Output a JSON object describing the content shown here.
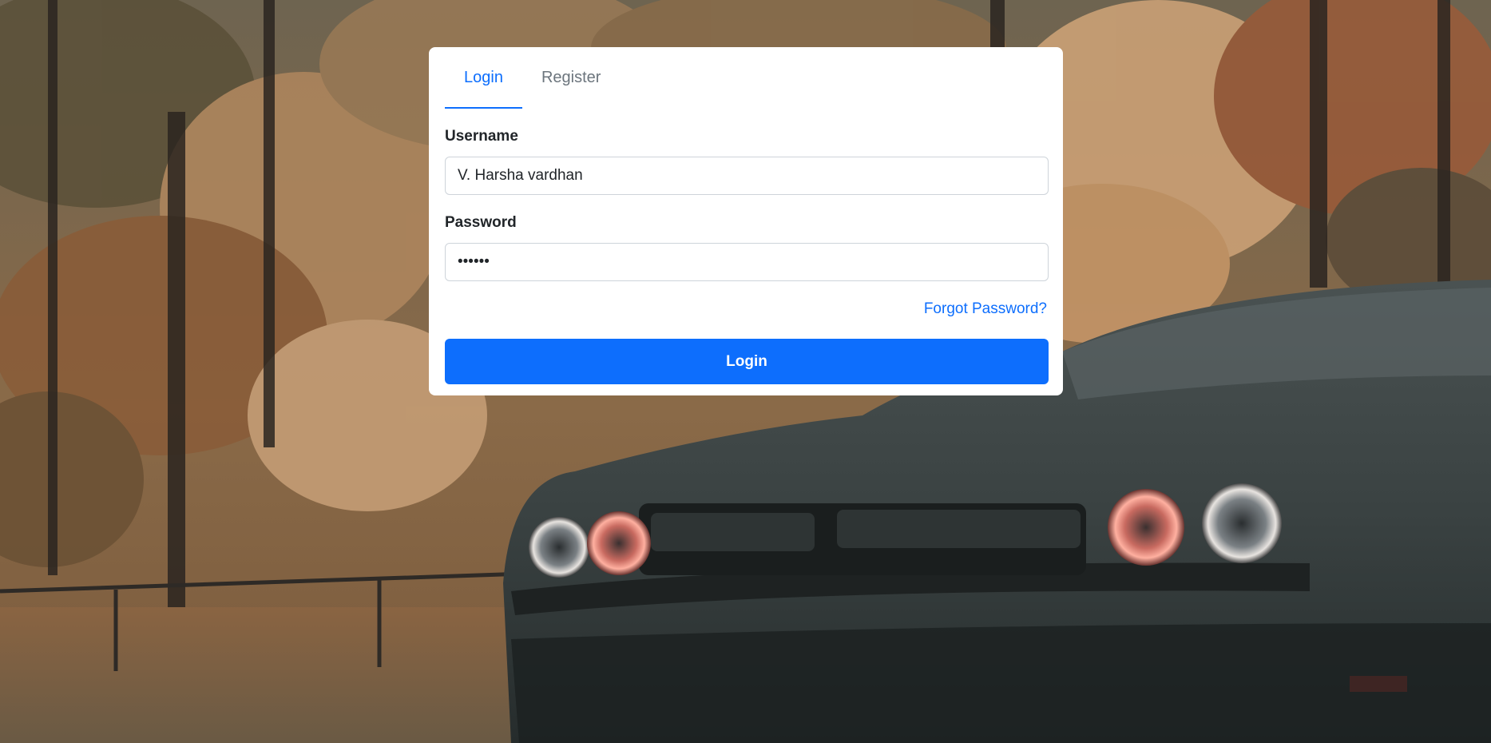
{
  "tabs": {
    "login_label": "Login",
    "register_label": "Register"
  },
  "form": {
    "username_label": "Username",
    "username_value": "V. Harsha vardhan",
    "password_label": "Password",
    "password_value": "••••••",
    "forgot_label": "Forgot Password?",
    "submit_label": "Login"
  },
  "colors": {
    "accent": "#0d6efd",
    "card_bg": "#ffffff",
    "muted_tab": "#6c757d"
  },
  "background": {
    "description_icon": "car-photo-background"
  }
}
